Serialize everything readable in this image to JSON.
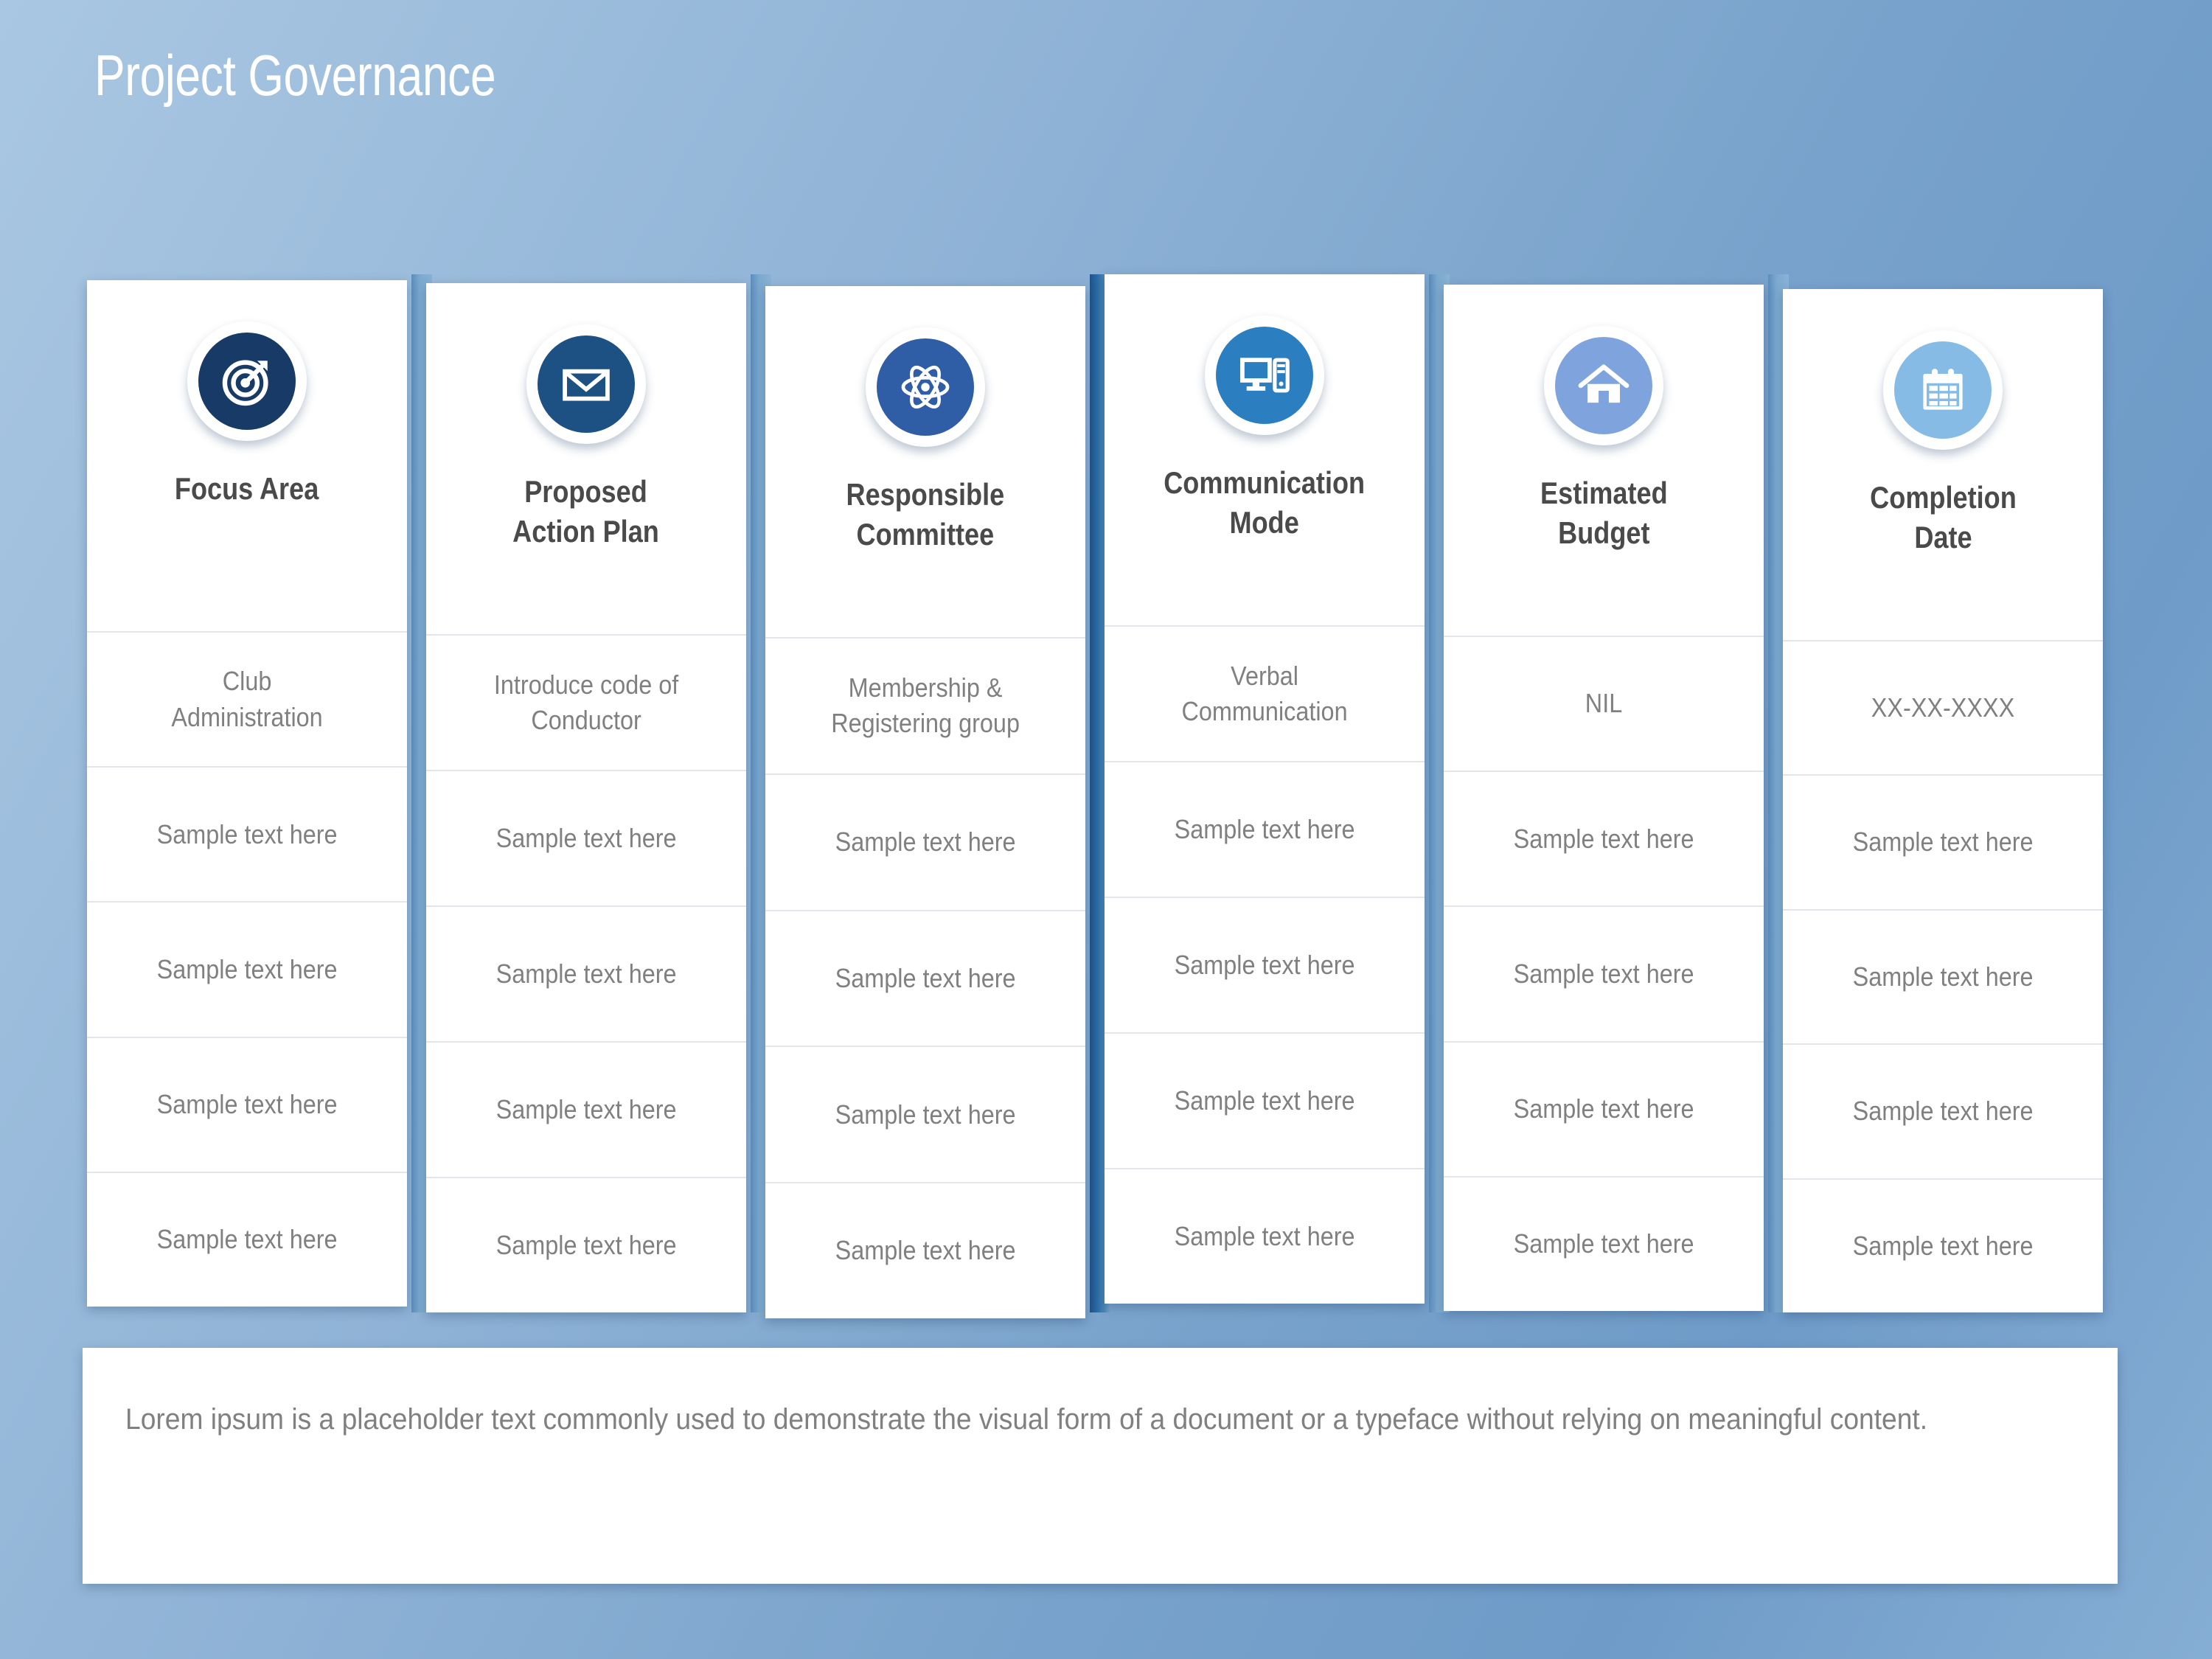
{
  "slide": {
    "title": "Project Governance",
    "background_color": "#8db1d5",
    "card_color": "#ffffff"
  },
  "table": {
    "columns": [
      {
        "icon": "target-icon",
        "icon_color": "#173a66",
        "header": "Focus Area",
        "cells": [
          "Club\nAdministration",
          "Sample text here",
          "Sample text here",
          "Sample text here",
          "Sample text here"
        ]
      },
      {
        "icon": "envelope-icon",
        "icon_color": "#1d5183",
        "header": "Proposed\nAction Plan",
        "cells": [
          "Introduce code of\nConductor",
          "Sample text here",
          "Sample text here",
          "Sample text here",
          "Sample text here"
        ]
      },
      {
        "icon": "atom-icon",
        "icon_color": "#2f5da6",
        "header": "Responsible\nCommittee",
        "cells": [
          "Membership &\nRegistering group",
          "Sample text here",
          "Sample text here",
          "Sample text here",
          "Sample text here"
        ]
      },
      {
        "icon": "desktop-computer-icon",
        "icon_color": "#2b7fc0",
        "header": "Communication\nMode",
        "cells": [
          "Verbal\nCommunication",
          "Sample text here",
          "Sample text here",
          "Sample text here",
          "Sample text here"
        ]
      },
      {
        "icon": "home-icon",
        "icon_color": "#7fa4dd",
        "header": "Estimated\nBudget",
        "cells": [
          "NIL",
          "Sample text here",
          "Sample text here",
          "Sample text here",
          "Sample text here"
        ]
      },
      {
        "icon": "calendar-icon",
        "icon_color": "#85bbe4",
        "header": "Completion\nDate",
        "cells": [
          "XX-XX-XXXX",
          "Sample text here",
          "Sample text here",
          "Sample text here",
          "Sample text here"
        ]
      }
    ]
  },
  "footer": {
    "note": "Lorem ipsum is a placeholder text commonly used to demonstrate the visual form of a document or a typeface without relying on meaningful content."
  }
}
